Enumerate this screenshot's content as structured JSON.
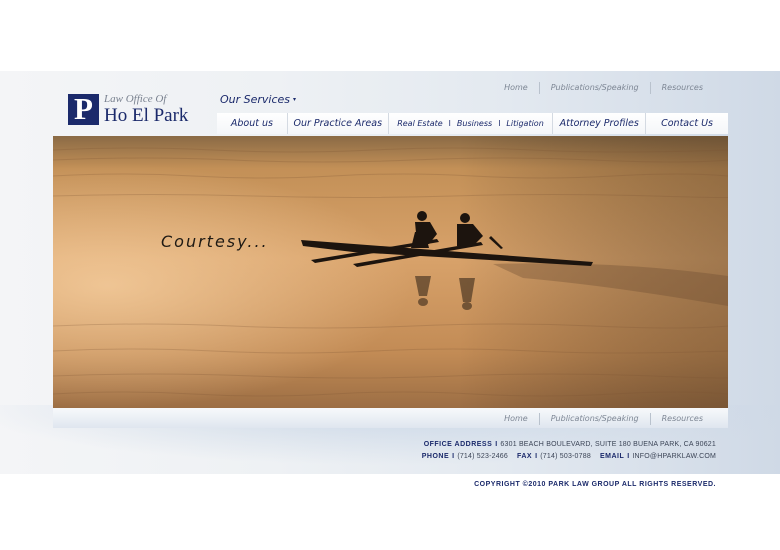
{
  "logo": {
    "mark": "P",
    "line1": "Law Office Of",
    "line2": "Ho El Park"
  },
  "top_links": [
    "Home",
    "Publications/Speaking",
    "Resources"
  ],
  "services": {
    "label": "Our Services",
    "caret": "▾"
  },
  "nav": {
    "about": "About us",
    "practice": "Our Practice Areas",
    "sub": [
      "Real Estate",
      "Business",
      "Litigation"
    ],
    "separator": "I",
    "profiles": "Attorney Profiles",
    "contact": "Contact Us"
  },
  "hero": {
    "caption": "Courtesy..."
  },
  "bottom_links": [
    "Home",
    "Publications/Speaking",
    "Resources"
  ],
  "contact": {
    "address_label": "OFFICE ADDRESS",
    "address": "6301 BEACH BOULEVARD, SUITE 180 BUENA PARK, CA  90621",
    "phone_label": "PHONE",
    "phone": "(714) 523-2466",
    "fax_label": "FAX",
    "fax": "(714) 503-0788",
    "email_label": "EMAIL",
    "email": "INFO@HPARKLAW.COM",
    "divider": "I"
  },
  "copyright": "COPYRIGHT ©2010 PARK LAW GROUP  ALL RIGHTS RESERVED.",
  "colors": {
    "brand": "#1b2a6b",
    "muted_link": "#7d8694",
    "water": "#c9914e"
  }
}
